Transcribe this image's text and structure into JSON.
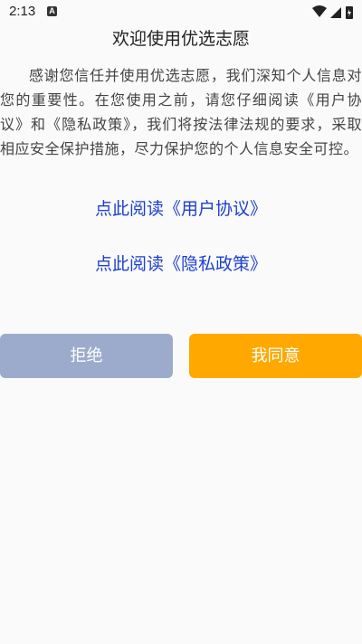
{
  "status_bar": {
    "time": "2:13",
    "notification_glyph": "A"
  },
  "dialog": {
    "title": "欢迎使用优选志愿",
    "body": "感谢您信任并使用优选志愿，我们深知个人信息对您的重要性。在您使用之前，请您仔细阅读《用户协议》和《隐私政策》，我们将按法律法规的要求，采取相应安全保护措施，尽力保护您的个人信息安全可控。",
    "link_user_agreement": "点此阅读《用户协议》",
    "link_privacy_policy": "点此阅读《隐私政策》",
    "refuse_label": "拒绝",
    "agree_label": "我同意"
  },
  "colors": {
    "link": "#1d3fcf",
    "refuse_button": "#9cabcc",
    "agree_button": "#ffa800",
    "background": "#fafafa"
  }
}
